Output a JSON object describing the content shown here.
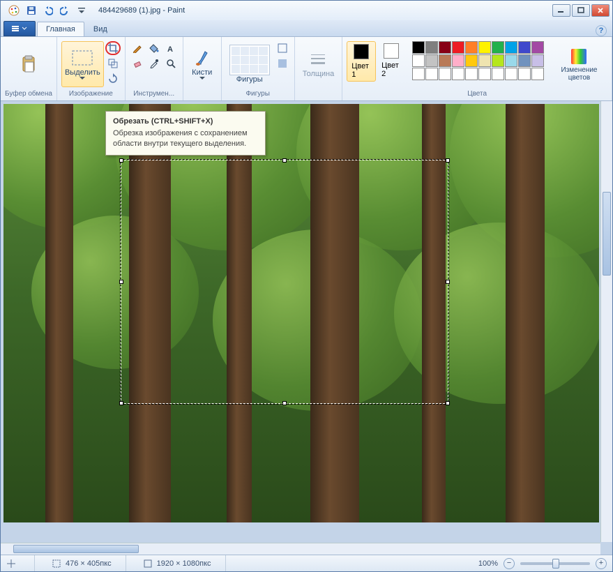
{
  "window": {
    "title": "484429689 (1).jpg - Paint"
  },
  "tabs": {
    "file_menu": "",
    "home": "Главная",
    "view": "Вид"
  },
  "ribbon": {
    "clipboard": {
      "label": "Буфер обмена",
      "paste": "Вставить"
    },
    "image": {
      "label": "Изображение",
      "select": "Выделить",
      "crop": "Обрезать",
      "resize": "Изменить размер",
      "rotate": "Повернуть"
    },
    "tools": {
      "label": "Инструмен..."
    },
    "brushes": {
      "label": "Кисти"
    },
    "shapes": {
      "label": "Фигуры",
      "btn": "Фигуры",
      "outline": "Контур",
      "fill": "Заливка"
    },
    "size": {
      "label": "Толщина"
    },
    "colors": {
      "label": "Цвета",
      "c1": "Цвет 1",
      "c2": "Цвет 2",
      "edit": "Изменение цветов"
    },
    "palette": [
      "#000000",
      "#7f7f7f",
      "#880015",
      "#ed1c24",
      "#ff7f27",
      "#fff200",
      "#22b14c",
      "#00a2e8",
      "#3f48cc",
      "#a349a4",
      "#ffffff",
      "#c3c3c3",
      "#b97a57",
      "#ffaec9",
      "#ffc90e",
      "#efe4b0",
      "#b5e61d",
      "#99d9ea",
      "#7092be",
      "#c8bfe7",
      "#ffffff",
      "#ffffff",
      "#ffffff",
      "#ffffff",
      "#ffffff",
      "#ffffff",
      "#ffffff",
      "#ffffff",
      "#ffffff",
      "#ffffff"
    ],
    "color1": "#000000",
    "color2": "#ffffff"
  },
  "tooltip": {
    "title": "Обрезать (CTRL+SHIFT+X)",
    "body": "Обрезка изображения с сохранением области внутри текущего выделения."
  },
  "statusbar": {
    "cursor": "",
    "selection": "476 × 405пкс",
    "canvas": "1920 × 1080пкс",
    "zoom": "100%"
  }
}
